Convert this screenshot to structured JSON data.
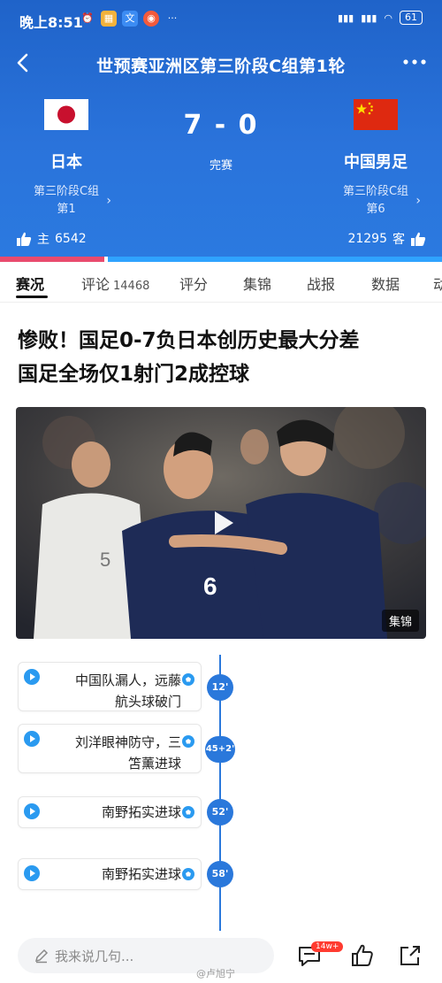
{
  "status_bar": {
    "time": "晚上8:51",
    "battery": "61"
  },
  "nav": {
    "title": "世预赛亚洲区第三阶段C组第1轮"
  },
  "match": {
    "home": {
      "name": "日本",
      "group_line1": "第三阶段C组",
      "group_line2": "第1",
      "like_label": "主",
      "likes": "6542"
    },
    "away": {
      "name": "中国男足",
      "group_line1": "第三阶段C组",
      "group_line2": "第6",
      "like_label": "客",
      "likes": "21295"
    },
    "score": "7 - 0",
    "status": "完赛",
    "home_like_fraction": 0.235,
    "colors": {
      "home_bar": "#e94b6e",
      "away_bar": "#2fa3ff",
      "header_bg": "#2a73db"
    }
  },
  "tabs": [
    {
      "label": "赛况"
    },
    {
      "label": "评论",
      "count": "14468"
    },
    {
      "label": "评分"
    },
    {
      "label": "集锦"
    },
    {
      "label": "战报"
    },
    {
      "label": "数据"
    },
    {
      "label": "动"
    }
  ],
  "article": {
    "headline_line1": "惨败！国足0-7负日本创历史最大分差",
    "headline_line2": "国足全场仅1射门2成控球",
    "photo_badge": "集锦"
  },
  "timeline": [
    {
      "text_line1": "中国队漏人，远藤",
      "text_line2": "航头球破门",
      "minute": "12'"
    },
    {
      "text_line1": "刘洋眼神防守，三",
      "text_line2": "笘薰进球",
      "minute": "45+2'"
    },
    {
      "text_line1": "南野拓实进球",
      "minute": "52'"
    },
    {
      "text_line1": "南野拓实进球",
      "minute": "58'"
    }
  ],
  "bottom": {
    "input_placeholder": "我来说几句...",
    "comment_badge": "14w+",
    "watermark": "@卢旭宁"
  }
}
